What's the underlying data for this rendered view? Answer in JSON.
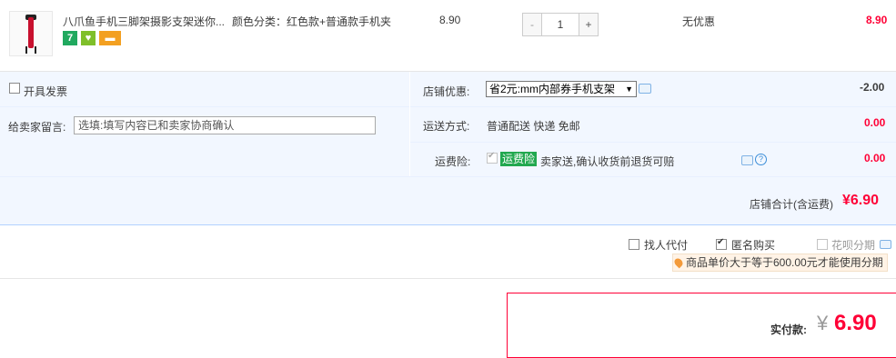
{
  "item": {
    "title": "八爪鱼手机三脚架摄影支架迷你...",
    "sku": "颜色分类：红色款+普通款手机夹",
    "unit_price": "8.90",
    "quantity": "1",
    "minus": "-",
    "plus": "+",
    "discount": "无优惠",
    "subtotal": "8.90",
    "badges": [
      {
        "icon": "seven-day-return-icon",
        "label": "7",
        "color": "#21a95f"
      },
      {
        "icon": "guarantee-icon",
        "label": "♥",
        "color": "#7fbf2a"
      },
      {
        "icon": "credit-card-icon",
        "label": "▬",
        "color": "#f3a021"
      }
    ]
  },
  "options": {
    "invoice_label": "开具发票",
    "message_label": "给卖家留言:",
    "message_placeholder": "选填:填写内容已和卖家协商确认",
    "shop_discount_label": "店铺优惠:",
    "shop_discount_selected": "省2元:mm内部券手机支架",
    "shop_discount_amount": "-2.00",
    "shipping_label": "运送方式:",
    "shipping_value": "普通配送 快递 免邮",
    "shipping_amount": "0.00",
    "insurance_label": "运费险:",
    "insurance_tag": "运费险",
    "insurance_desc": "卖家送,确认收货前退货可赔",
    "insurance_amount": "0.00",
    "shop_total_label": "店铺合计(含运费)",
    "shop_total_value": "¥6.90"
  },
  "payment": {
    "proxy_pay": "找人代付",
    "anonymous": "匿名购买",
    "huabei": "花呗分期",
    "huabei_tip": "商品单价大于等于600.00元才能使用分期",
    "actual_label": "实付款:",
    "currency": "¥",
    "actual_value": "6.90"
  },
  "colors": {
    "accent_red": "#ff0036",
    "panel_bg": "#f2f7ff",
    "border_blue": "#b2d1ff",
    "link_blue": "#3c8ed8"
  }
}
